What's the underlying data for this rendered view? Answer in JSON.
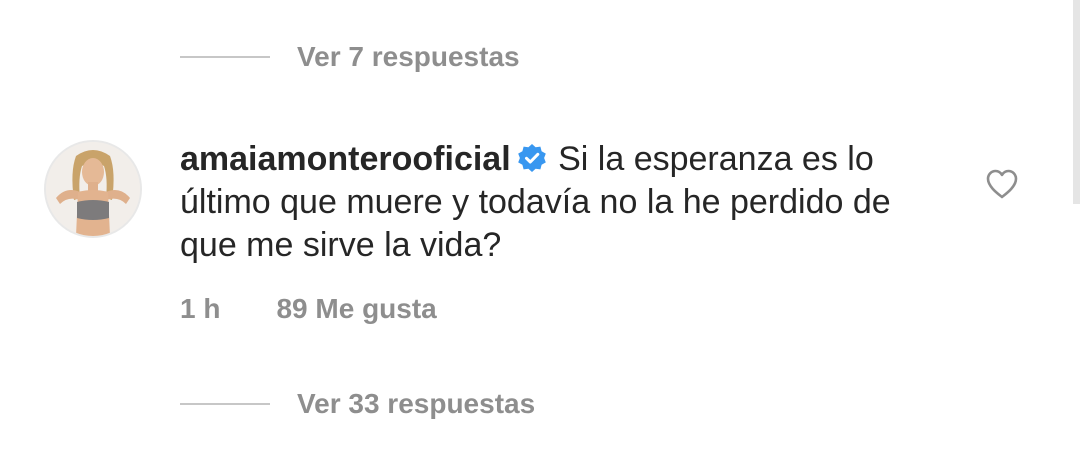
{
  "replies_top": {
    "label": "Ver 7 respuestas"
  },
  "comment": {
    "avatar_icon": "profile-photo-avatar",
    "username": "amaiamonterooficial",
    "verified_icon": "verified-badge-icon",
    "text": "Si la esperanza es lo último que muere  y todavía no la he perdido de que me sirve la vida?",
    "time": "1 h",
    "likes": "89 Me gusta",
    "like_icon": "heart-outline-icon"
  },
  "replies_bottom": {
    "label": "Ver 33 respuestas"
  },
  "colors": {
    "text": "#262626",
    "secondary": "#8e8e8e",
    "verified": "#3897f0"
  }
}
